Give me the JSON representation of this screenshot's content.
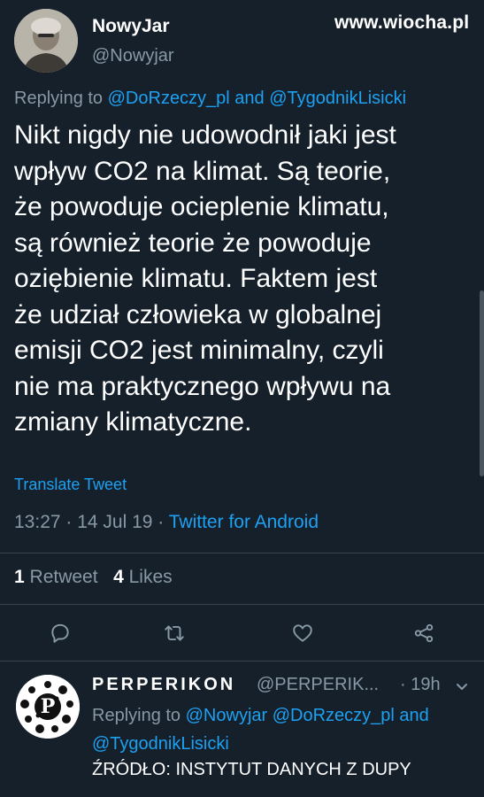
{
  "watermark": "www.wiocha.pl",
  "tweet": {
    "display_name": "NowyJar",
    "handle": "@Nowyjar",
    "replying_prefix": "Replying to ",
    "replying_user1": "@DoRzeczy_pl",
    "replying_and": " and ",
    "replying_user2": "@TygodnikLisicki",
    "body_lines": [
      "Nikt nigdy nie udowodnił jaki jest",
      "wpływ CO2 na klimat. Są teorie,",
      "że powoduje ocieplenie klimatu,",
      "są również teorie że powoduje",
      "oziębienie klimatu. Faktem jest",
      "że udział człowieka w globalnej",
      "emisji CO2 jest minimalny, czyli",
      "nie ma praktycznego wpływu na",
      "zmiany klimatyczne."
    ],
    "translate_label": "Translate Tweet",
    "time": "13:27",
    "sep1": " · ",
    "date": "14 Jul 19",
    "sep2": " · ",
    "source": "Twitter for Android",
    "retweet_count": "1",
    "retweet_label": "Retweet",
    "like_count": "4",
    "like_label": "Likes",
    "actions": [
      "reply-icon",
      "retweet-icon",
      "like-icon",
      "share-icon"
    ]
  },
  "reply": {
    "display_name": "PERPERIKON",
    "handle": "@PERPERIK...",
    "time": "· 19h",
    "replying_prefix": "Replying to ",
    "replying_users": "@Nowyjar @DoRzeczy_pl and @TygodnikLisicki",
    "text": "ŹRÓDŁO: INSTYTUT DANYCH Z DUPY",
    "avatar_letter": "P"
  },
  "colors": {
    "background": "#15202b",
    "secondary_text": "#8899a6",
    "link": "#1da1f2",
    "divider": "#38444d"
  }
}
